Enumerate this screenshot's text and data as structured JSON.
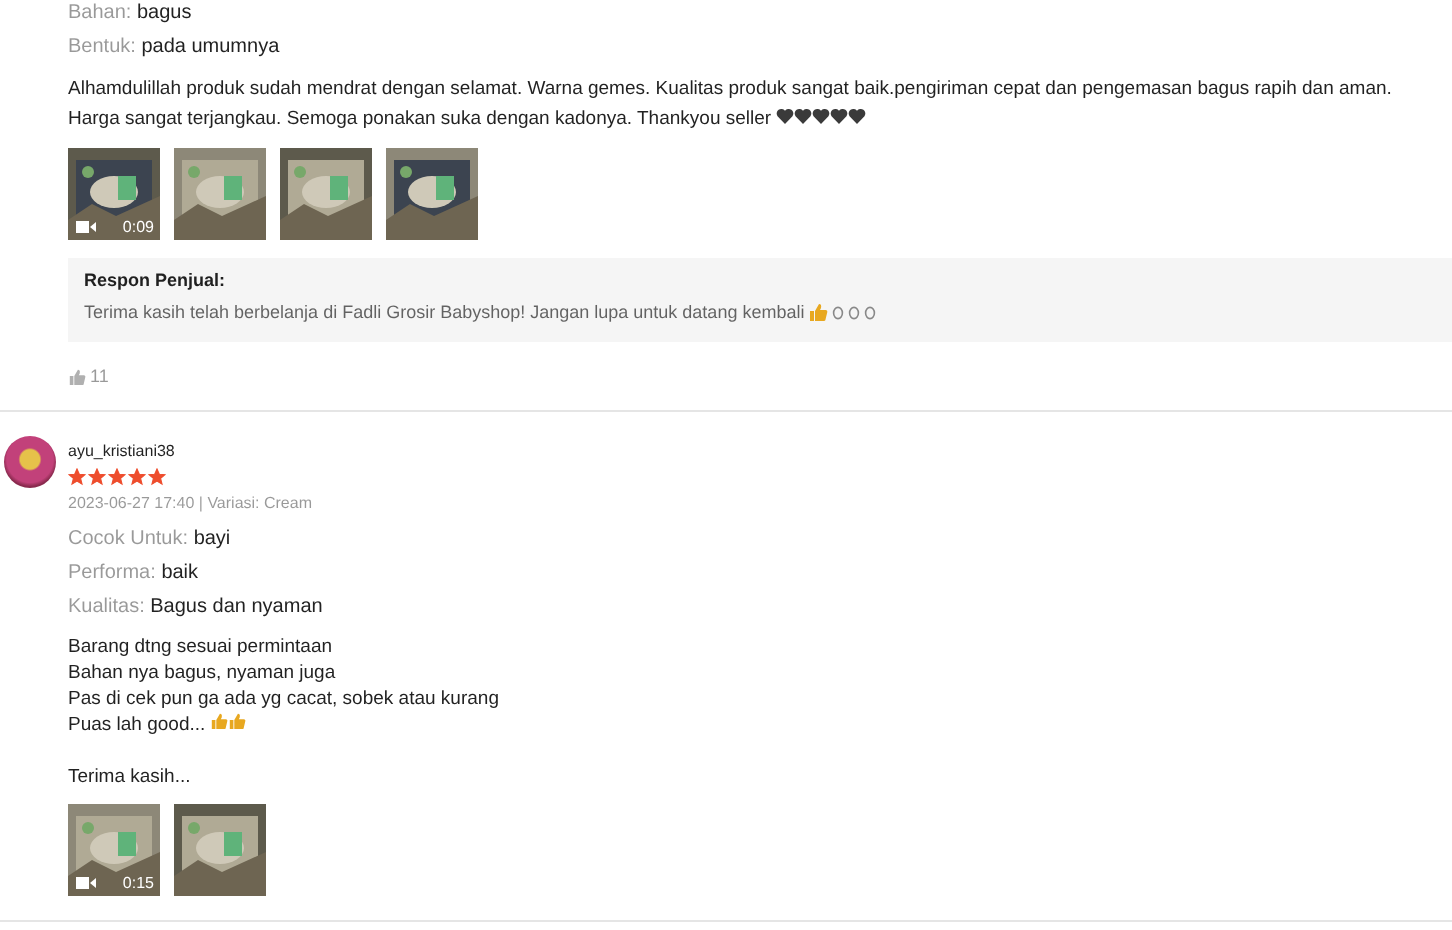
{
  "reviews": [
    {
      "attributes": [
        {
          "label": "Bahan:",
          "value": "bagus"
        },
        {
          "label": "Bentuk:",
          "value": "pada umumnya"
        }
      ],
      "comment": [
        [
          "Alhamdulillah produk sudah mendrat dengan selamat. Warna gemes. Kualitas produk sangat baik.pengiriman cepat dan pengemasan bagus rapih dan aman. Harga sangat terjangkau. Semoga ponakan suka dengan kadonya. Thankyou seller"
        ]
      ],
      "media": [
        {
          "kind": "video",
          "duration": "0:09"
        },
        {
          "kind": "picture"
        },
        {
          "kind": "picture"
        },
        {
          "kind": "picture"
        }
      ],
      "seller_response": {
        "title": "Respon Penjual:",
        "text": "Terima kasih telah berbelanja di Fadli Grosir Babyshop! Jangan lupa untuk datang kembali"
      },
      "likes": "11"
    },
    {
      "username": "ayu_kristiani38",
      "stars": 5,
      "meta": "2023-06-27 17:40 | Variasi: Cream",
      "attributes": [
        {
          "label": "Cocok Untuk:",
          "value": "bayi"
        },
        {
          "label": "Performa:",
          "value": "baik"
        },
        {
          "label": "Kualitas:",
          "value": "Bagus dan nyaman"
        }
      ],
      "comment": [
        [
          "Barang dtng sesuai permintaan",
          "Bahan nya bagus, nyaman juga",
          "Pas di cek pun ga ada yg cacat, sobek atau kurang",
          "Puas lah good..."
        ],
        [
          "Terima kasih..."
        ]
      ],
      "media": [
        {
          "kind": "video",
          "duration": "0:15"
        },
        {
          "kind": "picture"
        }
      ]
    }
  ]
}
